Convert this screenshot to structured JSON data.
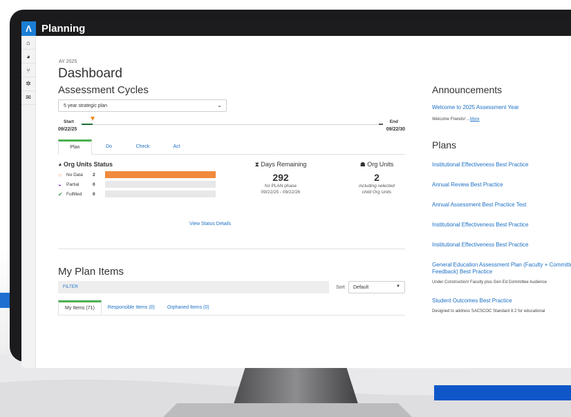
{
  "app": {
    "logo": "Λ",
    "title": "Planning"
  },
  "sidenav": [
    {
      "icon": "home-icon",
      "glyph": "⌂"
    },
    {
      "icon": "dashboard-icon",
      "glyph": "◕"
    },
    {
      "icon": "hierarchy-icon",
      "glyph": "⑂"
    },
    {
      "icon": "gear-icon",
      "glyph": "✲"
    },
    {
      "icon": "inbox-icon",
      "glyph": "✉"
    }
  ],
  "dashboard": {
    "ay_label": "AY 2025",
    "title": "Dashboard",
    "assessment_cycles_title": "Assessment Cycles",
    "cycle_select": "5 year strategic plan",
    "timeline": {
      "start_label": "Start",
      "start_date": "09/22/25",
      "end_label": "End",
      "end_date": "09/22/30",
      "progress": 0.03
    },
    "phase_tabs": [
      "Plan",
      "Do",
      "Check",
      "Act"
    ],
    "active_phase": "Plan",
    "org_status": {
      "title": "Org Units Status",
      "rows": [
        {
          "label": "No Data",
          "count": "2",
          "fraction": 1.0,
          "icon": "circle-outline-icon",
          "color": "#f08a3c"
        },
        {
          "label": "Partial",
          "count": "0",
          "fraction": 0,
          "icon": "half-circle-icon",
          "color": "#7b3fb5"
        },
        {
          "label": "Fulfilled",
          "count": "0",
          "fraction": 0,
          "icon": "check-circle-icon",
          "color": "#3aa04a"
        }
      ]
    },
    "days_remaining": {
      "title": "Days Remaining",
      "value": "292",
      "sub1": "for PLAN phase",
      "sub2": "09/22/25 - 09/22/26"
    },
    "org_units": {
      "title": "Org Units",
      "value": "2",
      "sub1": "including selected",
      "sub2": "child Org Units"
    },
    "view_status_link": "View Status Details"
  },
  "my_plan": {
    "title": "My Plan Items",
    "filter_label": "FILTER",
    "sort_label": "Sort",
    "sort_value": "Default",
    "tabs": [
      "My Items (71)",
      "Responsible Items (0)",
      "Orphaned Items (0)"
    ]
  },
  "announcements": {
    "title": "Announcements",
    "link": "Welcome to 2025 Assessment Year",
    "text": "Welcome Friends! ...",
    "more": "More"
  },
  "plans": {
    "title": "Plans",
    "items": [
      {
        "title": "Institutional Effectiveness Best Practice"
      },
      {
        "title": "Annual Review Best Practice"
      },
      {
        "title": "Annual Assessment Best Practice Test"
      },
      {
        "title": "Institutional Effectiveness Best Practice"
      },
      {
        "title": "Institutional Effectiveness Best Practice"
      },
      {
        "title": "General Education Assessment Plan (Faculty + Committee Feedback) Best Practice",
        "desc": "Under Construction! Faculty plus Gen Ed Committee Audience"
      },
      {
        "title": "Student Outcomes Best Practice",
        "desc": "Designed to address SACSCOC Standard 8.2 for educational"
      }
    ]
  },
  "colors": {
    "accent": "#1b6fc4",
    "tab_active": "#4caf50",
    "bar_fill": "#f08a3c",
    "promo_blue": "#0f57c8"
  }
}
